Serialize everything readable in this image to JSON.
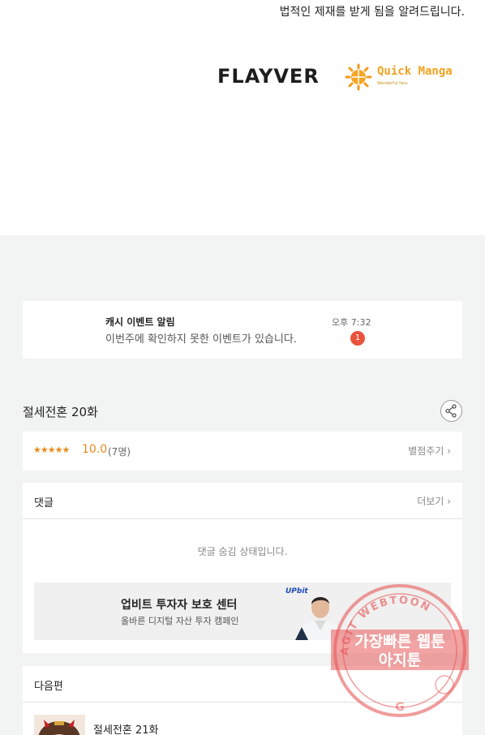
{
  "top": {
    "legal_text": "법적인 제재를 받게 됨을 알려드립니다.",
    "logo_flayver": "FLAYVER",
    "logo_quickmanga": "Quick Manga",
    "logo_quickmanga_sub": "Wonderful fans"
  },
  "notification": {
    "title": "캐시 이벤트 알림",
    "message": "이번주에 확인하지 못한 이벤트가 있습니다.",
    "time": "오후 7:32",
    "badge": "1"
  },
  "episode": {
    "title": "절세전혼 20화",
    "stars": "★★★★★",
    "score": "10.0",
    "count": "(7명)",
    "rate_label": "별점주기 ›"
  },
  "comments": {
    "title": "댓글",
    "more_label": "더보기 ›",
    "hidden_text": "댓글 숨김 상태입니다."
  },
  "ad": {
    "title": "업비트 투자자 보호 센터",
    "subtitle": "올바른 디지털 자산 투자 캠페인",
    "brand": "UPbit"
  },
  "next": {
    "title": "다음편",
    "episode_title": "절세전혼 21화"
  },
  "watermark": {
    "ring_text": "AGIT WEBTOON",
    "line1": "가장빠른 웹툰",
    "line2": "아지툰"
  },
  "colors": {
    "accent": "#e88a1a",
    "badge": "#e9533c",
    "stamp": "#e85a5a"
  }
}
